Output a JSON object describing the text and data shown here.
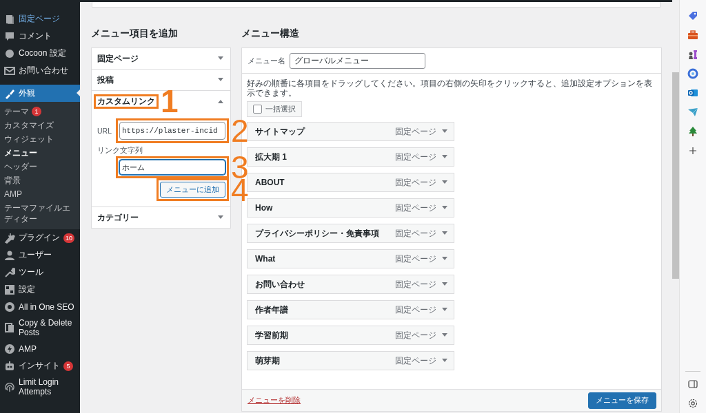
{
  "sidebar": {
    "items": [
      {
        "label": "固定ページ",
        "selected": false,
        "hovered": true
      },
      {
        "label": "コメント",
        "selected": false,
        "hovered": false
      },
      {
        "label": "Cocoon 設定",
        "selected": false,
        "hovered": false
      },
      {
        "label": "お問い合わせ",
        "selected": false,
        "hovered": false
      },
      {
        "label": "外観",
        "selected": true,
        "hovered": false,
        "children": [
          {
            "label": "テーマ",
            "badge": "1",
            "selected": false
          },
          {
            "label": "カスタマイズ",
            "selected": false
          },
          {
            "label": "ウィジェット",
            "selected": false
          },
          {
            "label": "メニュー",
            "selected": true
          },
          {
            "label": "ヘッダー",
            "selected": false
          },
          {
            "label": "背景",
            "selected": false
          },
          {
            "label": "AMP",
            "selected": false
          },
          {
            "label": "テーマファイルエディター",
            "selected": false
          }
        ]
      },
      {
        "label": "プラグイン",
        "badge": "10",
        "selected": false,
        "hovered": false
      },
      {
        "label": "ユーザー",
        "selected": false,
        "hovered": false
      },
      {
        "label": "ツール",
        "selected": false,
        "hovered": false
      },
      {
        "label": "設定",
        "selected": false,
        "hovered": false
      },
      {
        "label": "All in One SEO",
        "selected": false,
        "hovered": false
      },
      {
        "label": "Copy & Delete Posts",
        "selected": false,
        "hovered": false
      },
      {
        "label": "AMP",
        "selected": false,
        "hovered": false
      },
      {
        "label": "インサイト",
        "badge": "5",
        "selected": false,
        "hovered": false
      },
      {
        "label": "Limit Login Attempts",
        "selected": false,
        "hovered": false
      }
    ]
  },
  "add_panel": {
    "title": "メニュー項目を追加",
    "sections": [
      {
        "label": "固定ページ",
        "expanded": false,
        "highlighted": false
      },
      {
        "label": "投稿",
        "expanded": false,
        "highlighted": false
      },
      {
        "label": "カスタムリンク",
        "expanded": true,
        "highlighted": true,
        "annotation": "1",
        "fields": [
          {
            "label": "URL",
            "value": "https://plaster-incid",
            "focused": false,
            "highlighted": true,
            "annotation": "2"
          },
          {
            "label": "リンク文字列",
            "value": "ホーム",
            "focused": true,
            "highlighted": true,
            "annotation": "3"
          }
        ],
        "button": {
          "label": "メニューに追加",
          "highlighted": true,
          "annotation": "4"
        }
      },
      {
        "label": "カテゴリー",
        "expanded": false,
        "highlighted": false
      }
    ]
  },
  "structure": {
    "title": "メニュー構造",
    "menu_name_label": "メニュー名",
    "menu_name": "グローバルメニュー",
    "instructions": "好みの順番に各項目をドラッグしてください。項目の右側の矢印をクリックすると、追加設定オプションを表示できます。",
    "bulk_select": {
      "label": "一括選択",
      "checked": false
    },
    "items": [
      {
        "title": "サイトマップ",
        "type": "固定ページ"
      },
      {
        "title": "拡大期 1",
        "type": "固定ページ"
      },
      {
        "title": "ABOUT",
        "type": "固定ページ"
      },
      {
        "title": "How",
        "type": "固定ページ"
      },
      {
        "title": "プライバシーポリシー・免責事項",
        "type": "固定ページ"
      },
      {
        "title": "What",
        "type": "固定ページ"
      },
      {
        "title": "お問い合わせ",
        "type": "固定ページ"
      },
      {
        "title": "作者年譜",
        "type": "固定ページ"
      },
      {
        "title": "学習前期",
        "type": "固定ページ"
      },
      {
        "title": "萌芽期",
        "type": "固定ページ"
      }
    ],
    "delete_link": "メニューを削除",
    "save_button": "メニューを保存"
  }
}
